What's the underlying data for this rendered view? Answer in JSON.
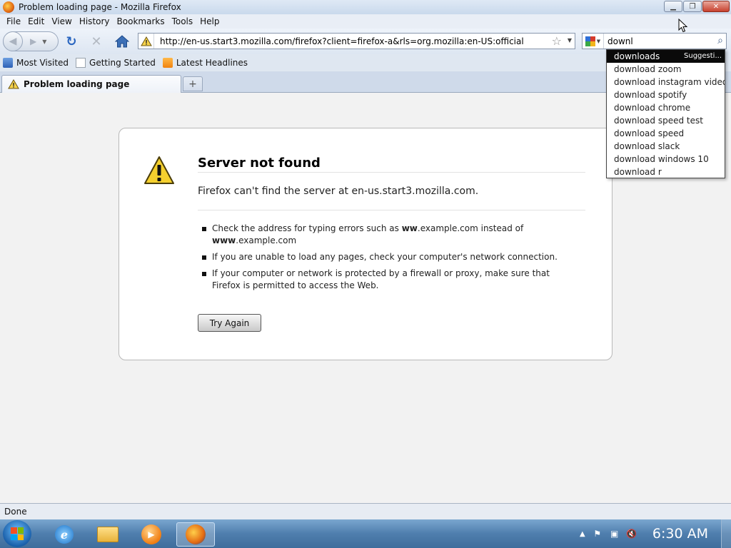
{
  "window": {
    "title": "Problem loading page - Mozilla Firefox"
  },
  "menu": [
    "File",
    "Edit",
    "View",
    "History",
    "Bookmarks",
    "Tools",
    "Help"
  ],
  "nav": {
    "url": "http://en-us.start3.mozilla.com/firefox?client=firefox-a&rls=org.mozilla:en-US:official",
    "search_value": "downl"
  },
  "bookmarks": [
    "Most Visited",
    "Getting Started",
    "Latest Headlines"
  ],
  "tab": {
    "label": "Problem loading page",
    "newtab_symbol": "+"
  },
  "error": {
    "title": "Server not found",
    "message": "Firefox can't find the server at en-us.start3.mozilla.com.",
    "items": [
      {
        "pre": "Check the address for typing errors such as ",
        "b1": "ww",
        "mid1": ".example.com instead of ",
        "b2": "www",
        "post": ".example.com"
      },
      {
        "text": "If you are unable to load any pages, check your computer's network connection."
      },
      {
        "text": "If your computer or network is protected by a firewall or proxy, make sure that Firefox is permitted to access the Web."
      }
    ],
    "button": "Try Again"
  },
  "suggestions": {
    "tag": "Suggesti...",
    "items": [
      "downloads",
      "download zoom",
      "download instagram videos",
      "download spotify",
      "download chrome",
      "download speed test",
      "download speed",
      "download slack",
      "download windows 10",
      "download r"
    ]
  },
  "status": "Done",
  "clock": "6:30 AM",
  "colors": {
    "accent": "#2a66c0",
    "selection": "#0a0a0a"
  }
}
